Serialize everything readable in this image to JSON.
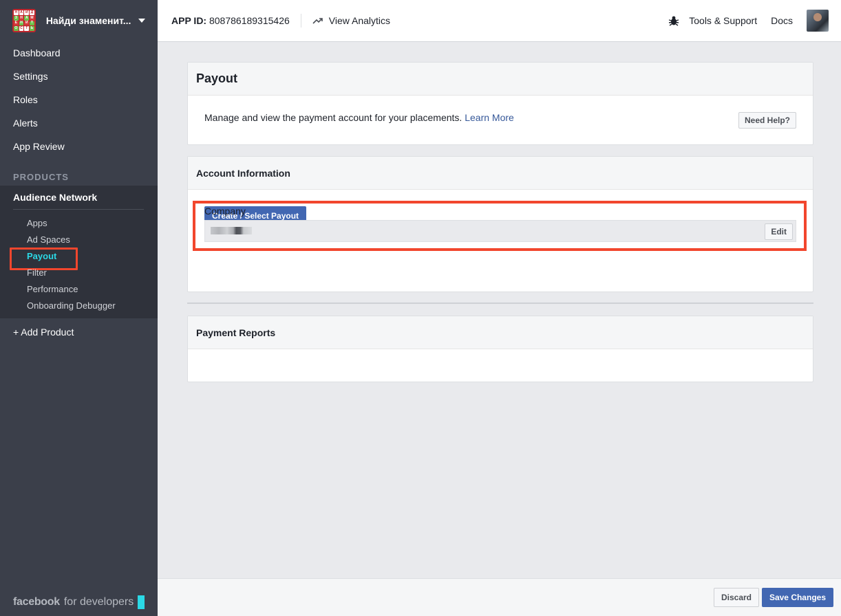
{
  "app": {
    "name": "Найди знаменит...",
    "logo_letters": [
      "Н",
      "А",
      "Й",
      "Д",
      "З",
      "Н",
      "А",
      "М",
      "Е",
      "Н",
      "И",
      "Т",
      "О",
      "С",
      "Т",
      "Ь"
    ]
  },
  "sidebar": {
    "items": [
      {
        "label": "Dashboard"
      },
      {
        "label": "Settings"
      },
      {
        "label": "Roles"
      },
      {
        "label": "Alerts"
      },
      {
        "label": "App Review"
      }
    ],
    "products_label": "PRODUCTS",
    "product": {
      "title": "Audience Network",
      "items": [
        {
          "label": "Apps"
        },
        {
          "label": "Ad Spaces"
        },
        {
          "label": "Payout",
          "active": true
        },
        {
          "label": "Filter"
        },
        {
          "label": "Performance"
        },
        {
          "label": "Onboarding Debugger"
        }
      ]
    },
    "add_product": "+ Add Product",
    "footer_brand": "facebook",
    "footer_suffix": "for developers"
  },
  "topbar": {
    "app_id_label": "APP ID:",
    "app_id_value": "808786189315426",
    "view_analytics": "View Analytics",
    "tools_support": "Tools & Support",
    "docs": "Docs"
  },
  "payout": {
    "title": "Payout",
    "description": "Manage and view the payment account for your placements.",
    "learn_more": "Learn More",
    "need_help": "Need Help?"
  },
  "account": {
    "title": "Account Information",
    "create_button": "Create / Select Payout",
    "company_label": "Company",
    "edit_button": "Edit"
  },
  "reports": {
    "title": "Payment Reports"
  },
  "footer": {
    "discard": "Discard",
    "save": "Save Changes"
  },
  "colors": {
    "sidebar_bg": "#3b3f4a",
    "accent_blue": "#4267b2",
    "active_cyan": "#2bd9e6",
    "highlight_red": "#f2462d",
    "link_blue": "#365899"
  }
}
